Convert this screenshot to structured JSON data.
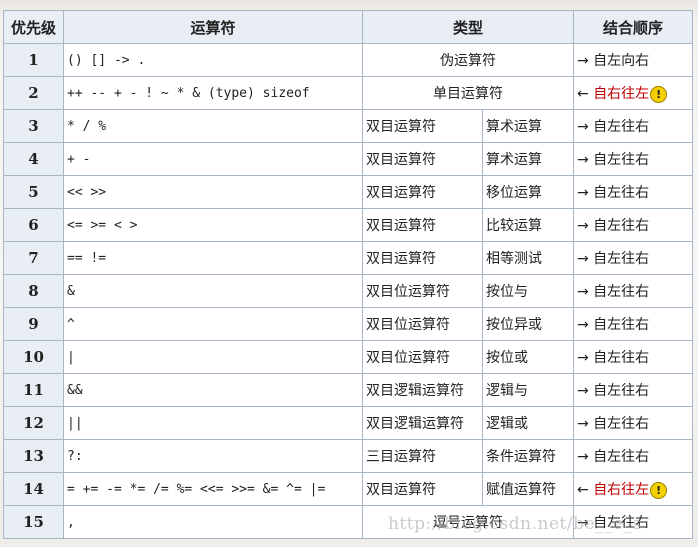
{
  "headers": {
    "priority": "优先级",
    "operator": "运算符",
    "type": "类型",
    "assoc": "结合顺序"
  },
  "rows": [
    {
      "priority": "1",
      "operator": "() [] -> .",
      "type": "伪运算符",
      "subtype": null,
      "assoc": "→ 自左向右",
      "rtl": false
    },
    {
      "priority": "2",
      "operator": "++ -- + - ! ~ * & (type) sizeof",
      "type": "单目运算符",
      "subtype": null,
      "assoc": "自右往左",
      "rtl": true
    },
    {
      "priority": "3",
      "operator": "* / %",
      "type": "双目运算符",
      "subtype": "算术运算",
      "assoc": "→ 自左往右",
      "rtl": false
    },
    {
      "priority": "4",
      "operator": "+ -",
      "type": "双目运算符",
      "subtype": "算术运算",
      "assoc": "→ 自左往右",
      "rtl": false
    },
    {
      "priority": "5",
      "operator": "<< >>",
      "type": "双目运算符",
      "subtype": "移位运算",
      "assoc": "→ 自左往右",
      "rtl": false
    },
    {
      "priority": "6",
      "operator": "<= >= < >",
      "type": "双目运算符",
      "subtype": "比较运算",
      "assoc": "→ 自左往右",
      "rtl": false
    },
    {
      "priority": "7",
      "operator": "== !=",
      "type": "双目运算符",
      "subtype": "相等测试",
      "assoc": "→ 自左往右",
      "rtl": false
    },
    {
      "priority": "8",
      "operator": "&",
      "type": "双目位运算符",
      "subtype": "按位与",
      "assoc": "→ 自左往右",
      "rtl": false
    },
    {
      "priority": "9",
      "operator": "^",
      "type": "双目位运算符",
      "subtype": "按位异或",
      "assoc": "→ 自左往右",
      "rtl": false
    },
    {
      "priority": "10",
      "operator": "|",
      "type": "双目位运算符",
      "subtype": "按位或",
      "assoc": "→ 自左往右",
      "rtl": false
    },
    {
      "priority": "11",
      "operator": "&&",
      "type": "双目逻辑运算符",
      "subtype": "逻辑与",
      "assoc": "→ 自左往右",
      "rtl": false
    },
    {
      "priority": "12",
      "operator": "||",
      "type": "双目逻辑运算符",
      "subtype": "逻辑或",
      "assoc": "→ 自左往右",
      "rtl": false
    },
    {
      "priority": "13",
      "operator": "?:",
      "type": "三目运算符",
      "subtype": "条件运算符",
      "assoc": "→ 自左往右",
      "rtl": false
    },
    {
      "priority": "14",
      "operator": "= += -= *= /= %= <<= >>= &= ^= |=",
      "type": "双目运算符",
      "subtype": "赋值运算符",
      "assoc": "自右往左",
      "rtl": true
    },
    {
      "priority": "15",
      "operator": ",",
      "type": "逗号运算符",
      "subtype": null,
      "assoc": "→ 自左往右",
      "rtl": false
    }
  ],
  "rtl_arrow": "←",
  "warn_symbol": "!",
  "watermark": "http://blog.csdn.net/be__e_s",
  "colors": {
    "header_bg": "#e8eef4",
    "border": "#a7b6c4",
    "rtl_text": "#c00000",
    "warn": "#f5d000"
  }
}
